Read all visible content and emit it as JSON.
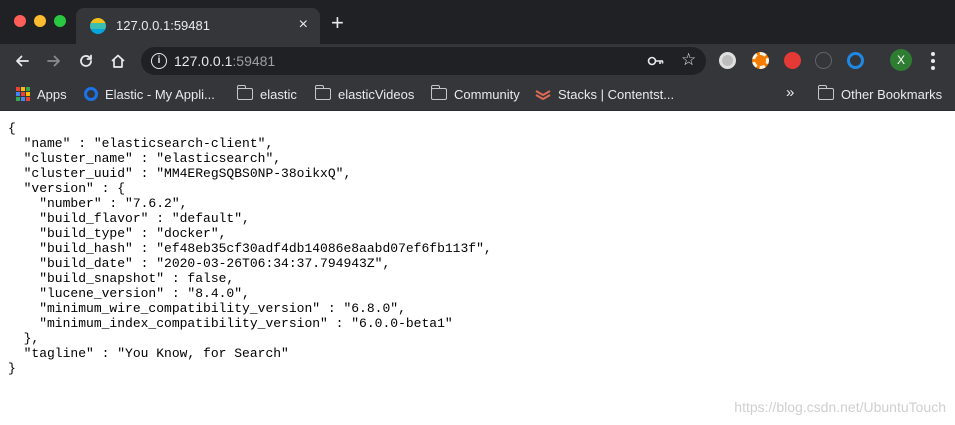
{
  "window": {
    "controls": {
      "close_color": "#ff5f57",
      "minimize_color": "#febc2e",
      "maximize_color": "#28c840"
    }
  },
  "tab": {
    "title": "127.0.0.1:59481",
    "favicon": "elastic-favicon",
    "close_glyph": "×"
  },
  "new_tab_glyph": "+",
  "nav": {
    "back_icon": "arrow-left-icon",
    "forward_icon": "arrow-right-icon",
    "reload_icon": "reload-icon",
    "home_icon": "home-icon"
  },
  "omnibox": {
    "host": "127.0.0.1",
    "port": ":59481",
    "info_glyph": "i",
    "key_icon": "key-icon",
    "star_glyph": "☆"
  },
  "extensions": [
    {
      "icon": "record-extension-icon",
      "color": "#bdbdbd"
    },
    {
      "icon": "lifebuoy-extension-icon",
      "color": "#f57c00"
    },
    {
      "icon": "stop-hand-extension-icon",
      "color": "#e53935"
    },
    {
      "icon": "info-extension-icon",
      "color": "#5f6368"
    },
    {
      "icon": "ring-extension-icon",
      "color": "#1e88e5"
    }
  ],
  "profile": {
    "initial": "X",
    "color": "#2e7d32"
  },
  "bookmarks": {
    "items": [
      {
        "label": "Apps",
        "icon": "apps-grid-icon"
      },
      {
        "label": "Elastic - My Appli...",
        "icon": "elastic-circle-icon"
      },
      {
        "label": "elastic",
        "icon": "folder-icon"
      },
      {
        "label": "elasticVideos",
        "icon": "folder-icon"
      },
      {
        "label": "Community",
        "icon": "folder-icon"
      },
      {
        "label": "Stacks | Contentst...",
        "icon": "contentstack-icon"
      }
    ],
    "overflow_glyph": "»",
    "other": {
      "label": "Other Bookmarks",
      "icon": "folder-icon"
    }
  },
  "page": {
    "json_lines": [
      "{",
      "  \"name\" : \"elasticsearch-client\",",
      "  \"cluster_name\" : \"elasticsearch\",",
      "  \"cluster_uuid\" : \"MM4ERegSQBS0NP-38oikxQ\",",
      "  \"version\" : {",
      "    \"number\" : \"7.6.2\",",
      "    \"build_flavor\" : \"default\",",
      "    \"build_type\" : \"docker\",",
      "    \"build_hash\" : \"ef48eb35cf30adf4db14086e8aabd07ef6fb113f\",",
      "    \"build_date\" : \"2020-03-26T06:34:37.794943Z\",",
      "    \"build_snapshot\" : false,",
      "    \"lucene_version\" : \"8.4.0\",",
      "    \"minimum_wire_compatibility_version\" : \"6.8.0\",",
      "    \"minimum_index_compatibility_version\" : \"6.0.0-beta1\"",
      "  },",
      "  \"tagline\" : \"You Know, for Search\"",
      "}"
    ],
    "watermark": "https://blog.csdn.net/UbuntuTouch"
  },
  "theme": {
    "chrome_dark": "#202124",
    "chrome_toolbar": "#35363a",
    "text_light": "#e8eaed"
  }
}
